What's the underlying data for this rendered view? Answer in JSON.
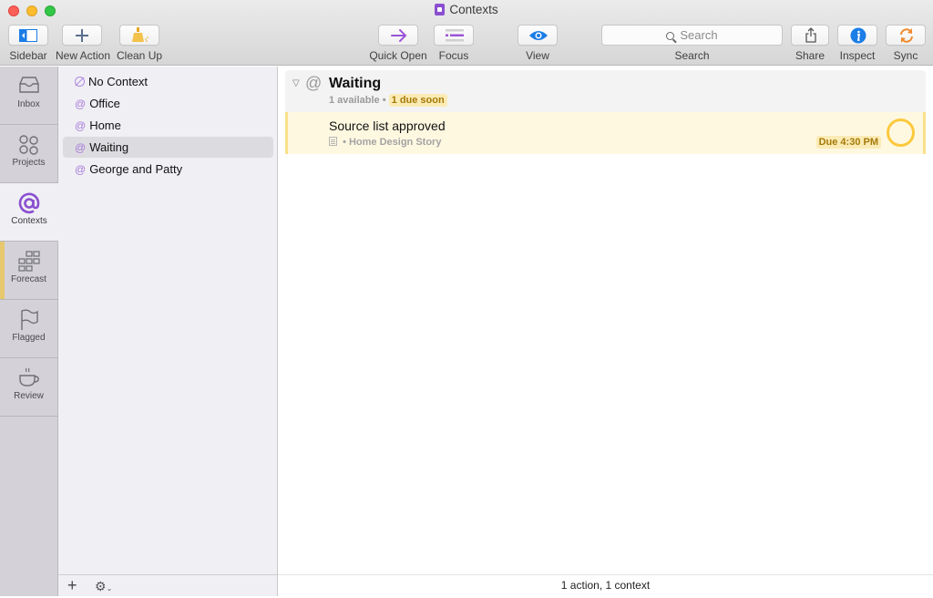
{
  "window": {
    "title": "Contexts"
  },
  "toolbar": {
    "sidebar_label": "Sidebar",
    "new_action_label": "New Action",
    "clean_up_label": "Clean Up",
    "quick_open_label": "Quick Open",
    "focus_label": "Focus",
    "view_label": "View",
    "search_label": "Search",
    "search_placeholder": "Search",
    "share_label": "Share",
    "inspect_label": "Inspect",
    "sync_label": "Sync"
  },
  "tabs": [
    {
      "label": "Inbox",
      "icon": "inbox-icon",
      "active": false
    },
    {
      "label": "Projects",
      "icon": "projects-icon",
      "active": false
    },
    {
      "label": "Contexts",
      "icon": "at-icon",
      "active": true
    },
    {
      "label": "Forecast",
      "icon": "forecast-icon",
      "active": false
    },
    {
      "label": "Flagged",
      "icon": "flag-icon",
      "active": false
    },
    {
      "label": "Review",
      "icon": "coffee-cup-icon",
      "active": false
    }
  ],
  "sidebar": {
    "contexts": [
      {
        "label": "No Context",
        "icon": "no-context-icon",
        "selected": false
      },
      {
        "label": "Office",
        "icon": "at-icon",
        "selected": false
      },
      {
        "label": "Home",
        "icon": "at-icon",
        "selected": false
      },
      {
        "label": "Waiting",
        "icon": "at-icon",
        "selected": true
      },
      {
        "label": "George and Patty",
        "icon": "at-icon",
        "selected": false
      }
    ],
    "footer": {
      "add_symbol": "+",
      "gear_symbol": "⚙"
    }
  },
  "main": {
    "group": {
      "disclosure": "▽",
      "at_symbol": "@",
      "title": "Waiting",
      "available": "1 available",
      "separator": "•",
      "due_soon": "1 due soon"
    },
    "actions": [
      {
        "title": "Source list approved",
        "project": "Home Design Story",
        "separator": "•",
        "due": "Due 4:30 PM"
      }
    ],
    "status": "1 action, 1 context"
  },
  "colors": {
    "accent_purple": "#8a4fd0",
    "due_soon_yellow": "#fbc93d",
    "due_text": "#a57a0a",
    "inspect_blue": "#1b7de6",
    "sync_orange": "#f08a2c"
  }
}
